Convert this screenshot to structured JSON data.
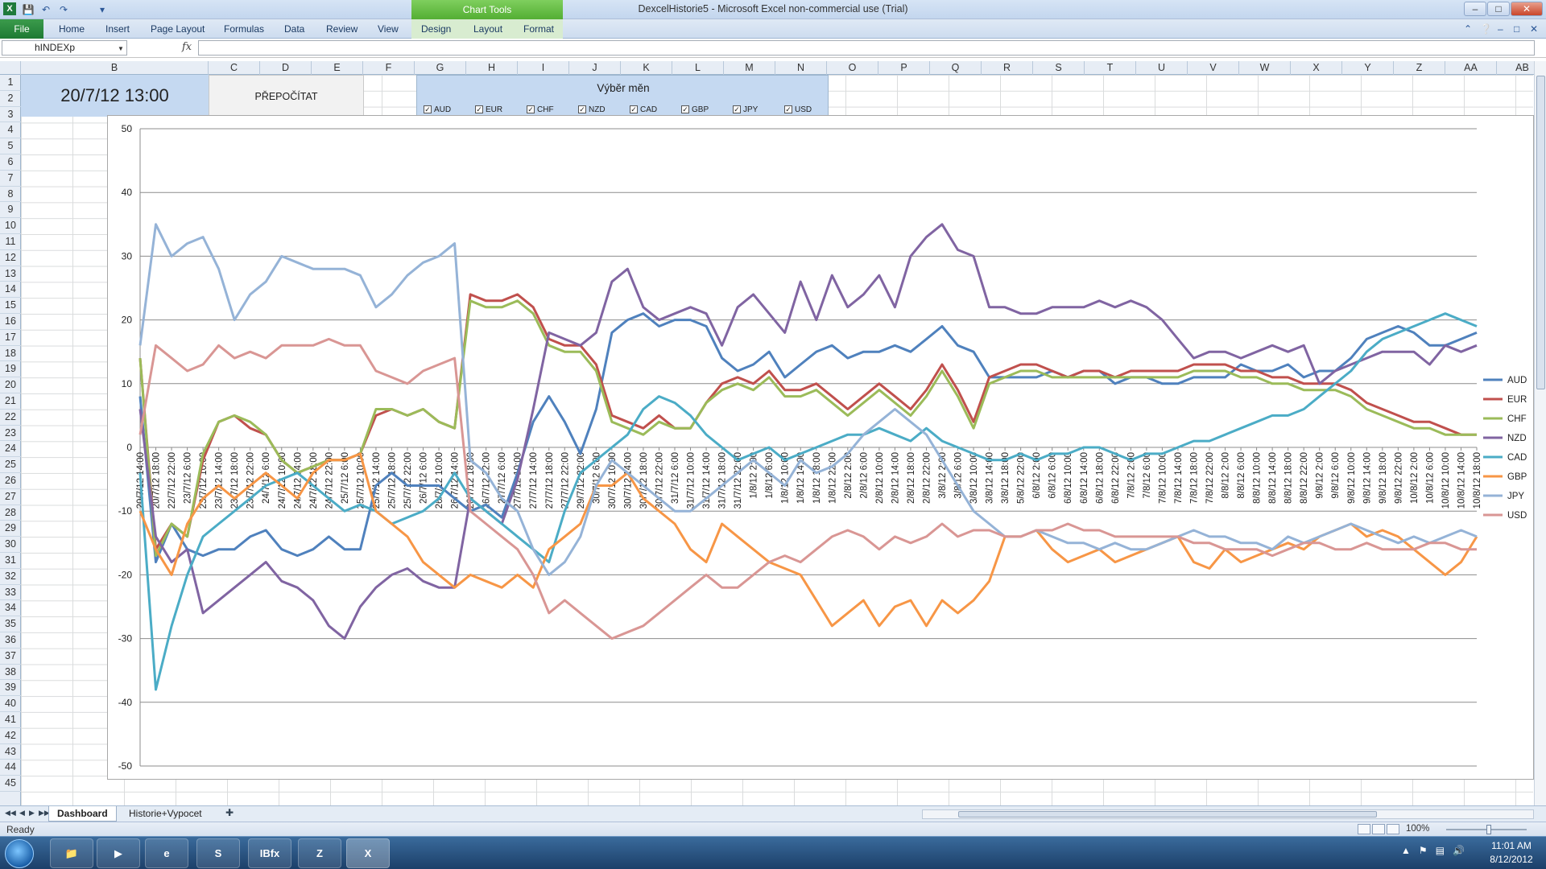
{
  "window": {
    "title": "DexcelHistorie5  -  Microsoft Excel non-commercial use (Trial)",
    "chart_tools_header": "Chart Tools"
  },
  "ribbon": {
    "file_label": "File",
    "tabs": [
      "Home",
      "Insert",
      "Page Layout",
      "Formulas",
      "Data",
      "Review",
      "View",
      "Design",
      "Layout",
      "Format"
    ]
  },
  "formula_bar": {
    "name_box": "hINDEXp",
    "fx_label": "fx",
    "formula": ""
  },
  "columns": [
    "B",
    "C",
    "D",
    "E",
    "F",
    "G",
    "H",
    "I",
    "J",
    "K",
    "L",
    "M",
    "N",
    "O",
    "P",
    "Q",
    "R",
    "S",
    "T",
    "U",
    "V",
    "W",
    "X",
    "Y",
    "Z",
    "AA",
    "AB"
  ],
  "rows": [
    "1",
    "2",
    "3",
    "4",
    "5",
    "6",
    "7",
    "8",
    "9",
    "10",
    "11",
    "12",
    "13",
    "14",
    "15",
    "16",
    "17",
    "18",
    "19",
    "20",
    "21",
    "22",
    "23",
    "24",
    "25",
    "26",
    "27",
    "28",
    "29",
    "30",
    "31",
    "32",
    "33",
    "34",
    "35",
    "36",
    "37",
    "38",
    "39",
    "40",
    "41",
    "42",
    "43",
    "44",
    "45"
  ],
  "dashboard": {
    "datetime": "20/7/12 13:00",
    "recalc_label": "PŘEPOČÍTAT",
    "currency_title": "Výběr měn",
    "currencies": [
      {
        "code": "AUD",
        "checked": true
      },
      {
        "code": "EUR",
        "checked": true
      },
      {
        "code": "CHF",
        "checked": true
      },
      {
        "code": "NZD",
        "checked": true
      },
      {
        "code": "CAD",
        "checked": true
      },
      {
        "code": "GBP",
        "checked": true
      },
      {
        "code": "JPY",
        "checked": true
      },
      {
        "code": "USD",
        "checked": true
      }
    ]
  },
  "chart_data": {
    "type": "line",
    "title": "",
    "xlabel": "",
    "ylabel": "",
    "ylim": [
      -50,
      50
    ],
    "yticks": [
      50,
      40,
      30,
      20,
      10,
      0,
      -10,
      -20,
      -30,
      -40,
      -50
    ],
    "legend_position": "right",
    "x": [
      "20/7/12 14:00",
      "20/7/12 18:00",
      "22/7/12 22:00",
      "23/7/12 6:00",
      "23/7/12 10:00",
      "23/7/12 14:00",
      "23/7/12 18:00",
      "23/7/12 22:00",
      "24/7/12 6:00",
      "24/7/12 10:00",
      "24/7/12 14:00",
      "24/7/12 18:00",
      "24/7/12 22:00",
      "25/7/12 6:00",
      "25/7/12 10:00",
      "25/7/12 14:00",
      "25/7/12 18:00",
      "25/7/12 22:00",
      "26/7/12 6:00",
      "26/7/12 10:00",
      "26/7/12 14:00",
      "26/7/12 18:00",
      "26/7/12 22:00",
      "27/7/12 6:00",
      "27/7/12 10:00",
      "27/7/12 14:00",
      "27/7/12 18:00",
      "27/7/12 22:00",
      "29/7/12 22:00",
      "30/7/12 6:00",
      "30/7/12 10:00",
      "30/7/12 14:00",
      "30/7/12 18:00",
      "30/7/12 22:00",
      "31/7/12 6:00",
      "31/7/12 10:00",
      "31/7/12 14:00",
      "31/7/12 18:00",
      "31/7/12 22:00",
      "1/8/12 2:00",
      "1/8/12 6:00",
      "1/8/12 10:00",
      "1/8/12 14:00",
      "1/8/12 18:00",
      "1/8/12 22:00",
      "2/8/12 2:00",
      "2/8/12 6:00",
      "2/8/12 10:00",
      "2/8/12 14:00",
      "2/8/12 18:00",
      "2/8/12 22:00",
      "3/8/12 2:00",
      "3/8/12 6:00",
      "3/8/12 10:00",
      "3/8/12 14:00",
      "3/8/12 18:00",
      "5/8/12 22:00",
      "6/8/12 2:00",
      "6/8/12 6:00",
      "6/8/12 10:00",
      "6/8/12 14:00",
      "6/8/12 18:00",
      "6/8/12 22:00",
      "7/8/12 2:00",
      "7/8/12 6:00",
      "7/8/12 10:00",
      "7/8/12 14:00",
      "7/8/12 18:00",
      "7/8/12 22:00",
      "8/8/12 2:00",
      "8/8/12 6:00",
      "8/8/12 10:00",
      "8/8/12 14:00",
      "8/8/12 18:00",
      "8/8/12 22:00",
      "9/8/12 2:00",
      "9/8/12 6:00",
      "9/8/12 10:00",
      "9/8/12 14:00",
      "9/8/12 18:00",
      "9/8/12 22:00",
      "10/8/12 2:00",
      "10/8/12 6:00",
      "10/8/12 10:00",
      "10/8/12 14:00",
      "10/8/12 18:00"
    ],
    "series": [
      {
        "name": "AUD",
        "color": "#4f81bd",
        "values": [
          8,
          -18,
          -12,
          -16,
          -17,
          -16,
          -16,
          -14,
          -13,
          -16,
          -17,
          -16,
          -14,
          -16,
          -16,
          -6,
          -4,
          -6,
          -6,
          -6,
          -8,
          -10,
          -9,
          -11,
          -4,
          4,
          8,
          4,
          -1,
          6,
          18,
          20,
          21,
          19,
          20,
          20,
          19,
          14,
          12,
          13,
          15,
          11,
          13,
          15,
          16,
          14,
          15,
          15,
          16,
          15,
          17,
          19,
          16,
          15,
          11,
          11,
          11,
          11,
          12,
          11,
          12,
          12,
          10,
          11,
          11,
          10,
          10,
          11,
          11,
          11,
          13,
          12,
          12,
          13,
          11,
          12,
          12,
          14,
          17,
          18,
          19,
          18,
          16,
          16,
          17,
          18
        ]
      },
      {
        "name": "EUR",
        "color": "#c0504d",
        "values": [
          14,
          -16,
          -12,
          -14,
          -2,
          4,
          5,
          3,
          2,
          -2,
          -4,
          -3,
          -2,
          -2,
          -1,
          5,
          6,
          5,
          6,
          4,
          3,
          24,
          23,
          23,
          24,
          22,
          17,
          16,
          16,
          13,
          5,
          4,
          3,
          5,
          3,
          3,
          7,
          10,
          11,
          10,
          12,
          9,
          9,
          10,
          8,
          6,
          8,
          10,
          8,
          6,
          9,
          13,
          9,
          4,
          11,
          12,
          13,
          13,
          12,
          11,
          12,
          12,
          11,
          12,
          12,
          12,
          12,
          13,
          13,
          13,
          12,
          12,
          11,
          11,
          10,
          10,
          10,
          9,
          7,
          6,
          5,
          4,
          4,
          3,
          2,
          2
        ]
      },
      {
        "name": "CHF",
        "color": "#9bbb59",
        "values": [
          14,
          -17,
          -12,
          -14,
          -1,
          4,
          5,
          4,
          2,
          -2,
          -4,
          -3,
          -2,
          -2,
          -1,
          6,
          6,
          5,
          6,
          4,
          3,
          23,
          22,
          22,
          23,
          21,
          16,
          15,
          15,
          12,
          4,
          3,
          2,
          4,
          3,
          3,
          7,
          9,
          10,
          9,
          11,
          8,
          8,
          9,
          7,
          5,
          7,
          9,
          7,
          5,
          8,
          12,
          8,
          3,
          10,
          11,
          12,
          12,
          11,
          11,
          11,
          11,
          11,
          11,
          11,
          11,
          11,
          12,
          12,
          12,
          11,
          11,
          10,
          10,
          9,
          9,
          9,
          8,
          6,
          5,
          4,
          3,
          3,
          2,
          2,
          2
        ]
      },
      {
        "name": "NZD",
        "color": "#8064a2",
        "values": [
          6,
          -14,
          -18,
          -16,
          -26,
          -24,
          -22,
          -20,
          -18,
          -21,
          -22,
          -24,
          -28,
          -30,
          -25,
          -22,
          -20,
          -19,
          -21,
          -22,
          -22,
          -8,
          -10,
          -12,
          -5,
          6,
          18,
          17,
          16,
          18,
          26,
          28,
          22,
          20,
          21,
          22,
          21,
          16,
          22,
          24,
          21,
          18,
          26,
          20,
          27,
          22,
          24,
          27,
          22,
          30,
          33,
          35,
          31,
          30,
          22,
          22,
          21,
          21,
          22,
          22,
          22,
          23,
          22,
          23,
          22,
          20,
          17,
          14,
          15,
          15,
          14,
          15,
          16,
          15,
          16,
          10,
          12,
          13,
          14,
          15,
          15,
          15,
          13,
          16,
          15,
          16
        ]
      },
      {
        "name": "CAD",
        "color": "#4bacc6",
        "values": [
          -4,
          -38,
          -28,
          -20,
          -14,
          -12,
          -10,
          -8,
          -6,
          -5,
          -4,
          -6,
          -8,
          -10,
          -9,
          -10,
          -12,
          -11,
          -10,
          -8,
          -4,
          -8,
          -10,
          -12,
          -14,
          -16,
          -18,
          -10,
          -4,
          -2,
          0,
          2,
          6,
          8,
          7,
          5,
          2,
          0,
          -2,
          -1,
          0,
          -2,
          -1,
          0,
          1,
          2,
          2,
          3,
          2,
          1,
          3,
          1,
          0,
          -1,
          -2,
          -2,
          -1,
          -2,
          -1,
          -1,
          0,
          0,
          -1,
          -2,
          -1,
          -1,
          0,
          1,
          1,
          2,
          3,
          4,
          5,
          5,
          6,
          8,
          10,
          12,
          15,
          17,
          18,
          19,
          20,
          21,
          20,
          19
        ]
      },
      {
        "name": "GBP",
        "color": "#f79646",
        "values": [
          -10,
          -16,
          -20,
          -12,
          -8,
          -6,
          -8,
          -6,
          -4,
          -6,
          -8,
          -4,
          -2,
          -2,
          -1,
          -10,
          -12,
          -14,
          -18,
          -20,
          -22,
          -20,
          -21,
          -22,
          -20,
          -22,
          -16,
          -14,
          -12,
          -6,
          -6,
          -4,
          -8,
          -10,
          -12,
          -16,
          -18,
          -12,
          -14,
          -16,
          -18,
          -19,
          -20,
          -24,
          -28,
          -26,
          -24,
          -28,
          -25,
          -24,
          -28,
          -24,
          -26,
          -24,
          -21,
          -14,
          -14,
          -13,
          -16,
          -18,
          -17,
          -16,
          -18,
          -17,
          -16,
          -15,
          -14,
          -18,
          -19,
          -16,
          -18,
          -17,
          -16,
          -15,
          -16,
          -14,
          -13,
          -12,
          -14,
          -13,
          -14,
          -16,
          -18,
          -20,
          -18,
          -14
        ]
      },
      {
        "name": "JPY",
        "color": "#95b3d7",
        "values": [
          16,
          35,
          30,
          32,
          33,
          28,
          20,
          24,
          26,
          30,
          29,
          28,
          28,
          28,
          27,
          22,
          24,
          27,
          29,
          30,
          32,
          -2,
          -4,
          -8,
          -10,
          -16,
          -20,
          -18,
          -14,
          -6,
          -2,
          -4,
          -6,
          -8,
          -10,
          -10,
          -8,
          -6,
          -4,
          -2,
          -4,
          -6,
          -2,
          -4,
          -3,
          -1,
          2,
          4,
          6,
          4,
          2,
          -2,
          -6,
          -10,
          -12,
          -14,
          -14,
          -13,
          -14,
          -15,
          -15,
          -16,
          -15,
          -16,
          -16,
          -15,
          -14,
          -13,
          -14,
          -14,
          -15,
          -15,
          -16,
          -14,
          -15,
          -14,
          -13,
          -12,
          -13,
          -14,
          -15,
          -14,
          -15,
          -14,
          -13,
          -14
        ]
      },
      {
        "name": "USD",
        "color": "#d99694",
        "values": [
          2,
          16,
          14,
          12,
          13,
          16,
          14,
          15,
          14,
          16,
          16,
          16,
          17,
          16,
          16,
          12,
          11,
          10,
          12,
          13,
          14,
          -10,
          -12,
          -14,
          -16,
          -20,
          -26,
          -24,
          -26,
          -28,
          -30,
          -29,
          -28,
          -26,
          -24,
          -22,
          -20,
          -22,
          -22,
          -20,
          -18,
          -17,
          -18,
          -16,
          -14,
          -13,
          -14,
          -16,
          -14,
          -15,
          -14,
          -12,
          -14,
          -13,
          -13,
          -14,
          -14,
          -13,
          -13,
          -12,
          -13,
          -13,
          -14,
          -14,
          -14,
          -14,
          -14,
          -15,
          -15,
          -16,
          -16,
          -16,
          -17,
          -16,
          -15,
          -15,
          -16,
          -16,
          -15,
          -16,
          -16,
          -16,
          -15,
          -15,
          -16,
          -16
        ]
      }
    ]
  },
  "sheet_tabs": [
    "Dashboard",
    "Historie+Vypocet"
  ],
  "status": {
    "text": "Ready",
    "zoom": "100%"
  },
  "taskbar": {
    "apps": [
      "explorer",
      "media-player",
      "internet-explorer",
      "skype",
      "IBfx",
      "zoom-app",
      "excel"
    ],
    "ibfx_label": "IBfx",
    "time": "11:01 AM",
    "date": "8/12/2012"
  }
}
